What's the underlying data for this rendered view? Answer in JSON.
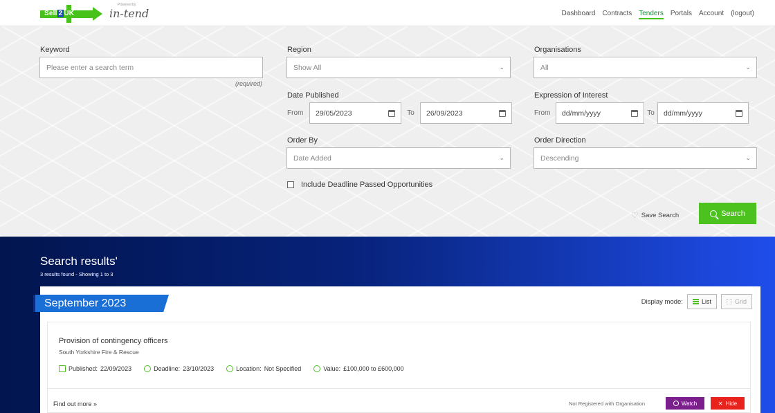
{
  "header": {
    "logo_sell2uk": "Sell",
    "logo_sell2uk_num": "2",
    "logo_sell2uk_uk": "UK",
    "logo_powered": "Powered by",
    "logo_intend": "in-tend",
    "nav": [
      "Dashboard",
      "Contracts",
      "Tenders",
      "Portals",
      "Account",
      "(logout)"
    ],
    "active_nav": "Tenders"
  },
  "search": {
    "keyword_label": "Keyword",
    "keyword_placeholder": "Please enter a search term",
    "keyword_required": "(required)",
    "region_label": "Region",
    "region_value": "Show All",
    "org_label": "Organisations",
    "org_value": "All",
    "date_published_label": "Date Published",
    "dp_from_label": "From",
    "dp_from_value": "29/05/2023",
    "dp_to_label": "To",
    "dp_to_value": "26/09/2023",
    "eoi_label": "Expression of Interest",
    "eoi_from_label": "From",
    "eoi_from_value": "dd/mm/yyyy",
    "eoi_to_label": "To",
    "eoi_to_value": "dd/mm/yyyy",
    "order_by_label": "Order By",
    "order_by_value": "Date Added",
    "order_dir_label": "Order Direction",
    "order_dir_value": "Descending",
    "include_passed_label": "Include Deadline Passed Opportunities",
    "include_passed_checked": false,
    "save_search_label": "Save Search",
    "search_button_label": "Search"
  },
  "results": {
    "title": "Search results'",
    "count_text": "3 results found - Showing 1 to 3",
    "month": "September 2023",
    "display_mode_label": "Display mode:",
    "list_label": "List",
    "grid_label": "Grid",
    "items": [
      {
        "title": "Provision of contingency officers",
        "organisation": "South Yorkshire Fire & Rescue",
        "published_label": "Published:",
        "published": "22/09/2023",
        "deadline_label": "Deadline:",
        "deadline": "23/10/2023",
        "location_label": "Location:",
        "location": "Not Specified",
        "value_label": "Value:",
        "value": "£100,000 to £600,000",
        "find_out_more": "Find out more",
        "registration_status": "Not Registered with Organisation",
        "watch_label": "Watch",
        "hide_label": "Hide"
      }
    ]
  },
  "colors": {
    "accent_green": "#4cc21f",
    "month_blue": "#1a6fd6",
    "watch_purple": "#7a1f8c",
    "hide_red": "#e8231e"
  }
}
